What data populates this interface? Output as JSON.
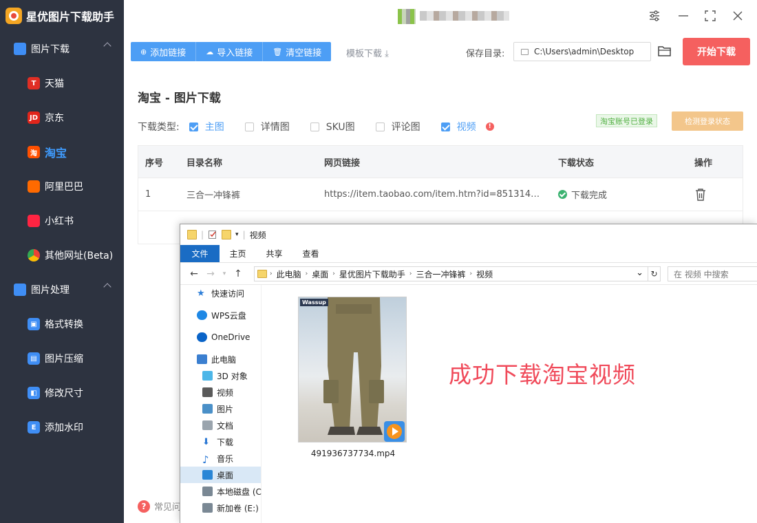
{
  "app": {
    "title": "星优图片下载助手"
  },
  "sidebar": {
    "groups": [
      {
        "label": "图片下载",
        "items": [
          {
            "label": "天猫",
            "icon": "T",
            "color": "#e02e24"
          },
          {
            "label": "京东",
            "icon": "JD",
            "color": "#e1251b"
          },
          {
            "label": "淘宝",
            "icon": "淘",
            "color": "#ff5000"
          },
          {
            "label": "阿里巴巴",
            "icon": "1688",
            "color": "#ff6a00"
          },
          {
            "label": "小红书",
            "icon": "小红书",
            "color": "#ff2442"
          },
          {
            "label": "其他网址(Beta)",
            "icon": "chrome",
            "color": "#4285f4"
          }
        ]
      },
      {
        "label": "图片处理",
        "items": [
          {
            "label": "格式转换",
            "icon": "image",
            "color": "#3f8ef5"
          },
          {
            "label": "图片压缩",
            "icon": "compress",
            "color": "#3f8ef5"
          },
          {
            "label": "修改尺寸",
            "icon": "resize",
            "color": "#3f8ef5"
          },
          {
            "label": "添加水印",
            "icon": "watermark",
            "color": "#3f8ef5"
          }
        ]
      }
    ]
  },
  "toolbar": {
    "add_link": "添加链接",
    "import_link": "导入链接",
    "clear_link": "清空链接",
    "template_download": "模板下载",
    "save_dir_label": "保存目录:",
    "save_dir_value": "C:\\Users\\admin\\Desktop",
    "start_download": "开始下载"
  },
  "main": {
    "section_title": "淘宝 - 图片下载",
    "download_type_label": "下载类型:",
    "types": [
      {
        "label": "主图",
        "checked": true
      },
      {
        "label": "详情图",
        "checked": false
      },
      {
        "label": "SKU图",
        "checked": false
      },
      {
        "label": "评论图",
        "checked": false
      },
      {
        "label": "视频",
        "checked": true
      }
    ],
    "login_status": "淘宝账号已登录",
    "check_login": "检测登录状态",
    "table": {
      "headers": [
        "序号",
        "目录名称",
        "网页链接",
        "下载状态",
        "操作"
      ],
      "rows": [
        {
          "index": "1",
          "name": "三合一冲锋裤",
          "url": "https://item.taobao.com/item.htm?id=851314538...",
          "status": "下载完成"
        }
      ]
    },
    "faq": "常见问"
  },
  "explorer": {
    "title": "视频",
    "ribbon_tabs": [
      "文件",
      "主页",
      "共享",
      "查看"
    ],
    "breadcrumb": [
      "此电脑",
      "桌面",
      "星优图片下载助手",
      "三合一冲锋裤",
      "视频"
    ],
    "search_placeholder": "在 视频 中搜索",
    "tree": [
      {
        "label": "快速访问",
        "icon": "star-icon",
        "indent": 1
      },
      {
        "label": "WPS云盘",
        "icon": "cloud-icon",
        "indent": 1
      },
      {
        "label": "OneDrive",
        "icon": "onedrive-icon",
        "indent": 1
      },
      {
        "label": "此电脑",
        "icon": "pc-icon",
        "indent": 1
      },
      {
        "label": "3D 对象",
        "icon": "cube-icon",
        "indent": 2
      },
      {
        "label": "视频",
        "icon": "video-icon",
        "indent": 2
      },
      {
        "label": "图片",
        "icon": "picture-icon",
        "indent": 2
      },
      {
        "label": "文档",
        "icon": "document-icon",
        "indent": 2
      },
      {
        "label": "下载",
        "icon": "download-icon",
        "indent": 2
      },
      {
        "label": "音乐",
        "icon": "music-icon",
        "indent": 2
      },
      {
        "label": "桌面",
        "icon": "desktop-icon",
        "indent": 2,
        "selected": true
      },
      {
        "label": "本地磁盘 (C",
        "icon": "disk-icon",
        "indent": 2
      },
      {
        "label": "新加卷 (E:)",
        "icon": "disk-icon",
        "indent": 2
      }
    ],
    "file": {
      "name": "491936737734.mp4",
      "thumb_brand": "Wassup"
    },
    "overlay_text": "成功下载淘宝视频"
  }
}
